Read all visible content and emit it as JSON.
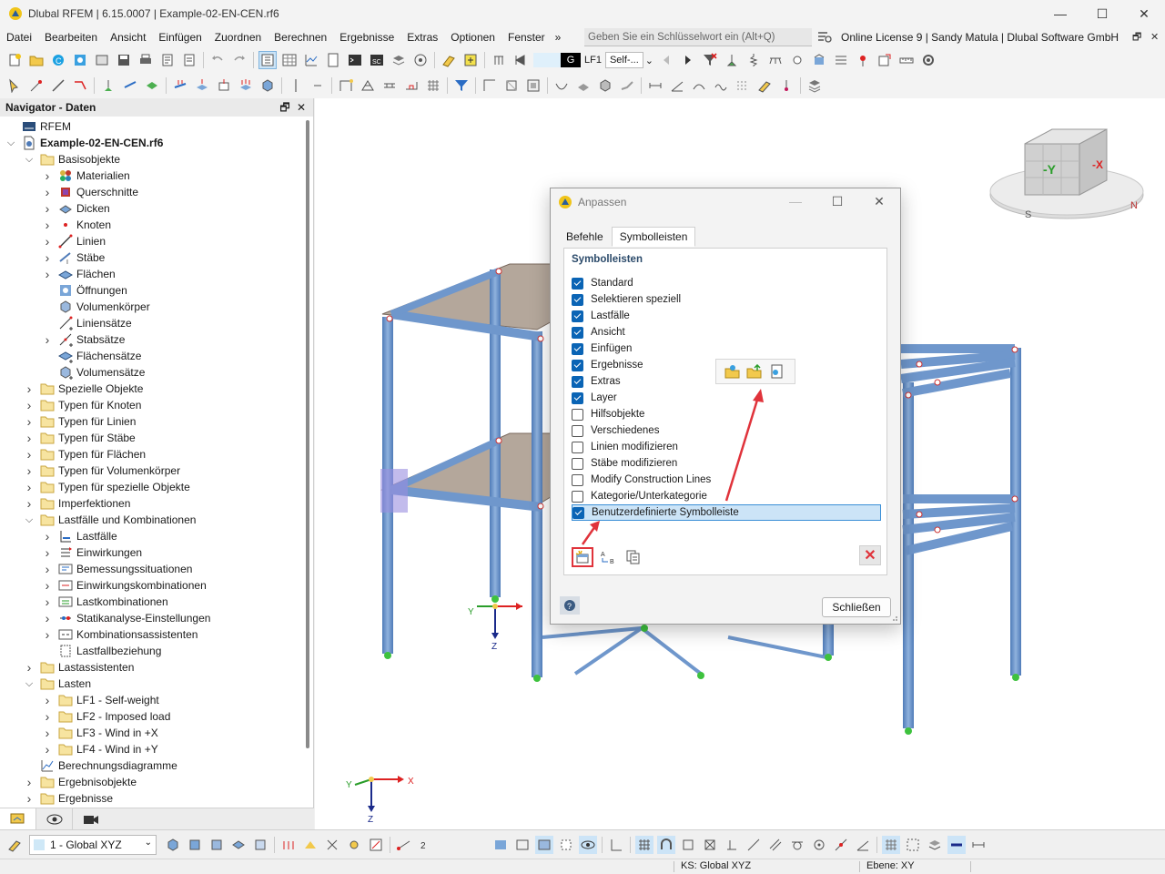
{
  "window": {
    "title": "Dlubal RFEM | 6.15.0007 | Example-02-EN-CEN.rf6",
    "minimize": "—",
    "maximize": "☐",
    "close": "✕"
  },
  "menu": {
    "items": [
      "Datei",
      "Bearbeiten",
      "Ansicht",
      "Einfügen",
      "Zuordnen",
      "Berechnen",
      "Ergebnisse",
      "Extras",
      "Optionen",
      "Fenster"
    ],
    "overflow": "»",
    "search_placeholder": "Geben Sie ein Schlüsselwort ein (Alt+Q)",
    "license": "Online License 9 | Sandy Matula | Dlubal Software GmbH",
    "mdi_restore": "🗗",
    "mdi_close": "✕"
  },
  "toolbar": {
    "load_case_color": "G",
    "load_case": "LF1",
    "load_case_name": "Self-..."
  },
  "navigator": {
    "title": "Navigator - Daten",
    "pin": "🗗",
    "close": "✕",
    "tree": [
      {
        "label": "RFEM",
        "level": 0,
        "chev": "",
        "icon": "rfem-icon"
      },
      {
        "label": "Example-02-EN-CEN.rf6",
        "level": 0,
        "chev": "v",
        "icon": "file-icon",
        "bold": true
      },
      {
        "label": "Basisobjekte",
        "level": 1,
        "chev": "v",
        "icon": "folder-icon"
      },
      {
        "label": "Materialien",
        "level": 2,
        "chev": ">",
        "icon": "materials-icon"
      },
      {
        "label": "Querschnitte",
        "level": 2,
        "chev": ">",
        "icon": "section-icon"
      },
      {
        "label": "Dicken",
        "level": 2,
        "chev": ">",
        "icon": "thickness-icon"
      },
      {
        "label": "Knoten",
        "level": 2,
        "chev": ">",
        "icon": "node-icon"
      },
      {
        "label": "Linien",
        "level": 2,
        "chev": ">",
        "icon": "line-icon"
      },
      {
        "label": "Stäbe",
        "level": 2,
        "chev": ">",
        "icon": "member-icon"
      },
      {
        "label": "Flächen",
        "level": 2,
        "chev": ">",
        "icon": "surface-icon"
      },
      {
        "label": "Öffnungen",
        "level": 2,
        "chev": "",
        "icon": "opening-icon"
      },
      {
        "label": "Volumenkörper",
        "level": 2,
        "chev": "",
        "icon": "solid-icon"
      },
      {
        "label": "Liniensätze",
        "level": 2,
        "chev": "",
        "icon": "line-set-icon"
      },
      {
        "label": "Stabsätze",
        "level": 2,
        "chev": ">",
        "icon": "member-set-icon"
      },
      {
        "label": "Flächensätze",
        "level": 2,
        "chev": "",
        "icon": "surface-set-icon"
      },
      {
        "label": "Volumensätze",
        "level": 2,
        "chev": "",
        "icon": "solid-set-icon"
      },
      {
        "label": "Spezielle Objekte",
        "level": 1,
        "chev": ">",
        "icon": "folder-icon"
      },
      {
        "label": "Typen für Knoten",
        "level": 1,
        "chev": ">",
        "icon": "folder-icon"
      },
      {
        "label": "Typen für Linien",
        "level": 1,
        "chev": ">",
        "icon": "folder-icon"
      },
      {
        "label": "Typen für Stäbe",
        "level": 1,
        "chev": ">",
        "icon": "folder-icon"
      },
      {
        "label": "Typen für Flächen",
        "level": 1,
        "chev": ">",
        "icon": "folder-icon"
      },
      {
        "label": "Typen für Volumenkörper",
        "level": 1,
        "chev": ">",
        "icon": "folder-icon"
      },
      {
        "label": "Typen für spezielle Objekte",
        "level": 1,
        "chev": ">",
        "icon": "folder-icon"
      },
      {
        "label": "Imperfektionen",
        "level": 1,
        "chev": ">",
        "icon": "folder-icon"
      },
      {
        "label": "Lastfälle und Kombinationen",
        "level": 1,
        "chev": "v",
        "icon": "folder-icon"
      },
      {
        "label": "Lastfälle",
        "level": 2,
        "chev": ">",
        "icon": "load-case-icon"
      },
      {
        "label": "Einwirkungen",
        "level": 2,
        "chev": ">",
        "icon": "action-icon"
      },
      {
        "label": "Bemessungssituationen",
        "level": 2,
        "chev": ">",
        "icon": "design-situation-icon"
      },
      {
        "label": "Einwirkungskombinationen",
        "level": 2,
        "chev": ">",
        "icon": "action-combination-icon"
      },
      {
        "label": "Lastkombinationen",
        "level": 2,
        "chev": ">",
        "icon": "load-combination-icon"
      },
      {
        "label": "Statikanalyse-Einstellungen",
        "level": 2,
        "chev": ">",
        "icon": "analysis-settings-icon"
      },
      {
        "label": "Kombinationsassistenten",
        "level": 2,
        "chev": ">",
        "icon": "combination-wizard-icon"
      },
      {
        "label": "Lastfallbeziehung",
        "level": 2,
        "chev": "",
        "icon": "relationship-icon"
      },
      {
        "label": "Lastassistenten",
        "level": 1,
        "chev": ">",
        "icon": "folder-icon"
      },
      {
        "label": "Lasten",
        "level": 1,
        "chev": "v",
        "icon": "folder-icon"
      },
      {
        "label": "LF1 - Self-weight",
        "level": 2,
        "chev": ">",
        "icon": "folder-icon"
      },
      {
        "label": "LF2 - Imposed load",
        "level": 2,
        "chev": ">",
        "icon": "folder-icon"
      },
      {
        "label": "LF3 - Wind in +X",
        "level": 2,
        "chev": ">",
        "icon": "folder-icon"
      },
      {
        "label": "LF4 - Wind in +Y",
        "level": 2,
        "chev": ">",
        "icon": "folder-icon"
      },
      {
        "label": "Berechnungsdiagramme",
        "level": 1,
        "chev": "",
        "icon": "diagram-icon"
      },
      {
        "label": "Ergebnisobjekte",
        "level": 1,
        "chev": ">",
        "icon": "folder-icon"
      },
      {
        "label": "Ergebnisse",
        "level": 1,
        "chev": ">",
        "icon": "folder-icon"
      }
    ]
  },
  "viewport": {
    "axis_labels": {
      "x": "X",
      "y": "Y",
      "z": "Z"
    },
    "cube_labels": {
      "neg_y": "-Y",
      "neg_x": "-X",
      "south": "S",
      "north": "N"
    }
  },
  "dialog": {
    "title": "Anpassen",
    "tabs": [
      "Befehle",
      "Symbolleisten"
    ],
    "active_tab": "Symbolleisten",
    "section": "Symbolleisten",
    "toolbars": [
      {
        "label": "Standard",
        "checked": true
      },
      {
        "label": "Selektieren speziell",
        "checked": true
      },
      {
        "label": "Lastfälle",
        "checked": true
      },
      {
        "label": "Ansicht",
        "checked": true
      },
      {
        "label": "Einfügen",
        "checked": true
      },
      {
        "label": "Ergebnisse",
        "checked": true
      },
      {
        "label": "Extras",
        "checked": true
      },
      {
        "label": "Layer",
        "checked": true
      },
      {
        "label": "Hilfsobjekte",
        "checked": false
      },
      {
        "label": "Verschiedenes",
        "checked": false
      },
      {
        "label": "Linien modifizieren",
        "checked": false
      },
      {
        "label": "Stäbe modifizieren",
        "checked": false
      },
      {
        "label": "Modify Construction Lines",
        "checked": false
      },
      {
        "label": "Kategorie/Unterkategorie",
        "checked": false
      },
      {
        "label": "Benutzerdefinierte Symbolleiste",
        "checked": true,
        "selected": true
      }
    ],
    "close_label": "Schließen",
    "delete_icon": "✕",
    "highlight_color": "#e0333b"
  },
  "statusbar": {
    "view": "1 - Global XYZ",
    "coordinate_system": "KS: Global XYZ",
    "plane": "Ebene: XY"
  }
}
